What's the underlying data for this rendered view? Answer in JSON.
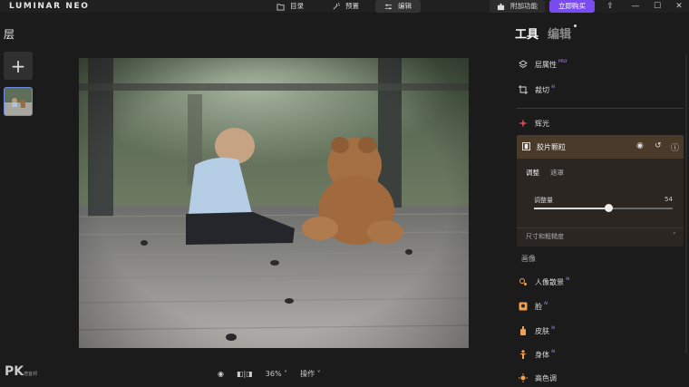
{
  "app": {
    "logo": "LUMINAR NEO"
  },
  "topbar": {
    "catalog": "目录",
    "presets": "预置",
    "edit": "编辑",
    "addons": "附加功能",
    "buy": "立即购买"
  },
  "layers": {
    "title": "层"
  },
  "bottom": {
    "zoom": "36%",
    "actions": "操作"
  },
  "watermark": {
    "main": "PK",
    "sub": "痞客邦"
  },
  "panel": {
    "tab_tools": "工具",
    "tab_edit": "编辑",
    "tools": [
      {
        "label": "层属性",
        "tag": "PRO"
      },
      {
        "label": "裁切",
        "tag": "AI"
      },
      {
        "label": "辉光",
        "tag": ""
      }
    ],
    "grain": {
      "title": "胶片颗粒",
      "sub_tabs": [
        "调整",
        "遮罩"
      ],
      "amount_label": "调整量",
      "amount_value": "54",
      "amount_fraction": 0.54,
      "size_section": "尺寸和粗糙度"
    },
    "portrait_section": "画像",
    "portrait_tools": [
      {
        "label": "人像散景",
        "tag": "AI"
      },
      {
        "label": "脸",
        "tag": "AI"
      },
      {
        "label": "皮肤",
        "tag": "AI"
      },
      {
        "label": "身体",
        "tag": "AI"
      },
      {
        "label": "高色调",
        "tag": ""
      }
    ]
  },
  "colors": {
    "accent": "#7a4cf0",
    "grain_header": "#4a3a2a",
    "tag": "#c08cff"
  }
}
